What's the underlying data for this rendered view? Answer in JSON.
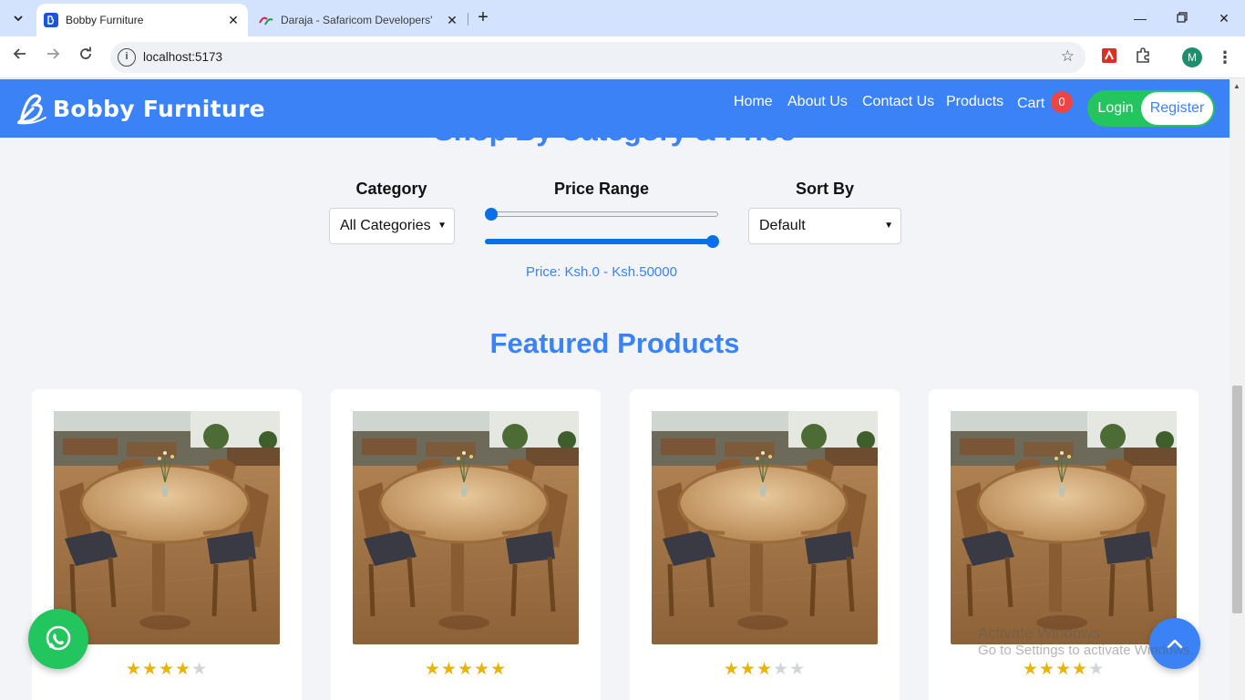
{
  "browser": {
    "tabs": [
      {
        "title": "Bobby Furniture",
        "active": true
      },
      {
        "title": "Daraja - Safaricom Developers'",
        "active": false
      }
    ],
    "url": "localhost:5173",
    "profile_initial": "M"
  },
  "site": {
    "brand": "Bobby Furniture",
    "nav": {
      "home": "Home",
      "about": "About Us",
      "contact": "Contact Us",
      "products": "Products",
      "cart": "Cart",
      "cart_count": "0"
    },
    "auth": {
      "login": "Login",
      "register": "Register"
    }
  },
  "partial_heading": "Shop By Category & Price",
  "filters": {
    "category_label": "Category",
    "category_value": "All Categories",
    "price_label": "Price Range",
    "price_min": 0,
    "price_max": 50000,
    "price_text": "Price: Ksh.0 - Ksh.50000",
    "sort_label": "Sort By",
    "sort_value": "Default"
  },
  "featured": {
    "title": "Featured Products",
    "products": [
      {
        "rating": 4
      },
      {
        "rating": 5
      },
      {
        "rating": 3
      },
      {
        "rating": 4
      }
    ]
  },
  "watermark": {
    "line1": "Activate Windows",
    "line2": "Go to Settings to activate Windows."
  },
  "colors": {
    "brand": "#3b82f6",
    "success": "#22c55e",
    "badge": "#ef4444",
    "star": "#eab308"
  }
}
